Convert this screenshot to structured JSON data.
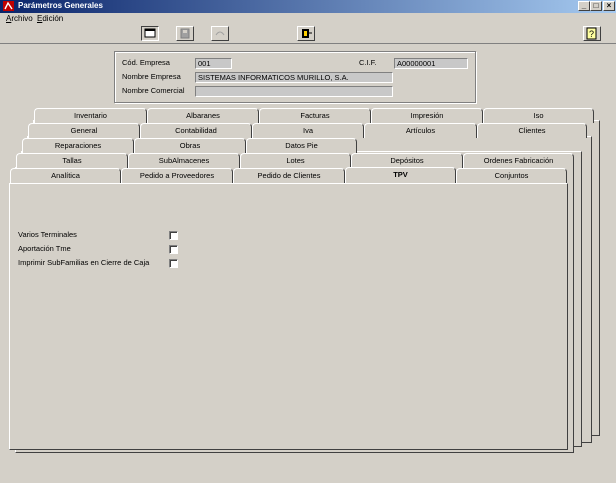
{
  "window": {
    "title": "Parámetros Generales"
  },
  "menubar": {
    "items": [
      {
        "label": "Archivo"
      },
      {
        "label": "Edición"
      }
    ]
  },
  "company": {
    "cod_label": "Cód. Empresa",
    "cod_value": "001",
    "cif_label": "C.I.F.",
    "cif_value": "A00000001",
    "nombre_label": "Nombre Empresa",
    "nombre_value": "SISTEMAS INFORMATICOS MURILLO, S.A.",
    "comercial_label": "Nombre Comercial",
    "comercial_value": ""
  },
  "tabs": {
    "row1": [
      "Inventario",
      "Albaranes",
      "Facturas",
      "Impresión",
      "Iso"
    ],
    "row2": [
      "General",
      "Contabilidad",
      "Iva",
      "Artículos",
      "Clientes"
    ],
    "row3": [
      "Reparaciones",
      "Obras",
      "Datos Pie"
    ],
    "row4": [
      "Tallas",
      "SubAlmacenes",
      "Lotes",
      "Depósitos",
      "Ordenes Fabricación"
    ],
    "row5": [
      "Analítica",
      "Pedido a Proveedores",
      "Pedido de Clientes",
      "TPV",
      "Conjuntos"
    ],
    "active": "TPV"
  },
  "tpv": {
    "options": [
      {
        "label": "Varios Terminales",
        "checked": false
      },
      {
        "label": "Aportación Tme",
        "checked": false
      },
      {
        "label": "Imprimir SubFamilias en Cierre de Caja",
        "checked": false
      }
    ]
  },
  "icons": {
    "app": "app-icon",
    "minimize": "minimize-icon",
    "maximize": "maximize-icon",
    "close": "close-icon",
    "tool1": "window-icon",
    "tool2": "save-icon",
    "tool3": "undo-icon",
    "tool4": "exit-icon",
    "help": "help-icon"
  }
}
